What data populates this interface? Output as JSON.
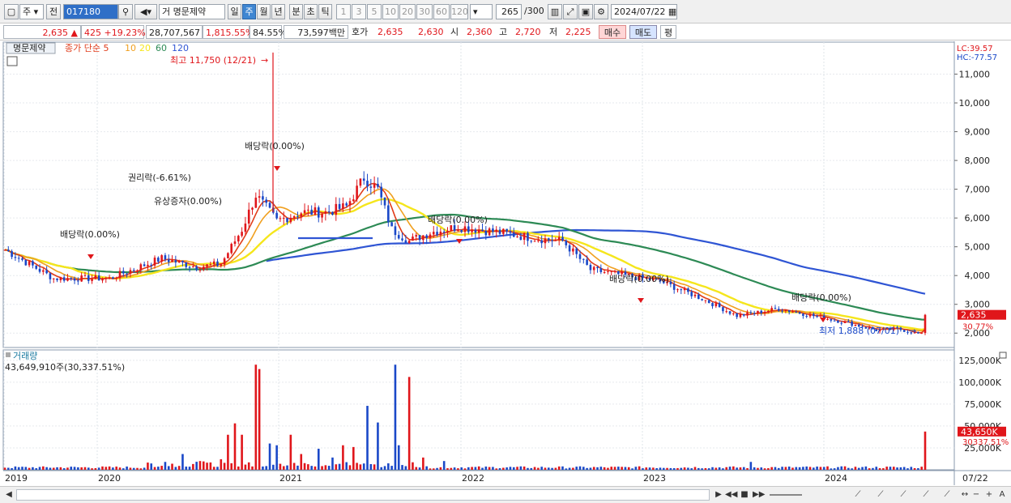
{
  "toolbar": {
    "mode": "주",
    "prev": "전",
    "code": "017180",
    "type": "거",
    "name": "명문제약",
    "periods": [
      "일",
      "주",
      "월",
      "년",
      "분",
      "초",
      "틱"
    ],
    "period_active": "주",
    "intervals": [
      "1",
      "3",
      "5",
      "10",
      "20",
      "30",
      "60",
      "120"
    ],
    "count": "265",
    "count_total": "/300",
    "date": "2024/07/22"
  },
  "quote": {
    "price": "2,635",
    "arrow": "▲",
    "change": "425",
    "change_pct": "+19.23%",
    "volume": "28,707,567",
    "volume_pct": "1,815.55%",
    "turnover_pct": "84.55%",
    "amount": "73,597백만",
    "hoga_label": "호가",
    "ask": "2,635",
    "bid": "2,630",
    "open_label": "시",
    "open": "2,360",
    "high_label": "고",
    "high": "2,720",
    "low_label": "저",
    "low": "2,225",
    "buy_label": "매수",
    "sell_label": "매도",
    "eval_label": "평"
  },
  "legend": {
    "stock": "명문제약",
    "ma_label": "종가 단순",
    "ma_periods": [
      "5",
      "10",
      "20",
      "60",
      "120"
    ],
    "lc": "LC:39.57",
    "hc": "HC:-77.57"
  },
  "annotations": {
    "high": "최고 11,750 (12/21)",
    "low": "최저 1,888 (07/01)",
    "div1": "배당락(0.00%)",
    "rights": "권리락(-6.61%)",
    "bonus": "유상증자(0.00%)",
    "div2": "배당락(0.00%)",
    "div3": "배당락(0.00%)",
    "div4": "배당락(0.00%)",
    "div5": "배당락(0.00%)"
  },
  "price_axis": {
    "labels": [
      "11,000",
      "10,000",
      "9,000",
      "8,000",
      "7,000",
      "6,000",
      "5,000",
      "4,000",
      "3,000",
      "2,000"
    ],
    "current": "2,635",
    "current_pct": "30.77%"
  },
  "volume_panel": {
    "title": "거래량",
    "value": "43,649,910주(30,337.51%)",
    "labels": [
      "125,000K",
      "100,000K",
      "75,000K",
      "50,000K",
      "25,000K"
    ],
    "current": "43,650K",
    "current_pct": "30337.51%"
  },
  "time_axis": {
    "labels": [
      "2019",
      "2020",
      "2021",
      "2022",
      "2023",
      "2024"
    ],
    "last": "07/22"
  },
  "colors": {
    "up": "#e0161b",
    "down": "#1a48c8",
    "ma5": "#e03c1a",
    "ma10": "#f0a020",
    "ma20": "#f5e61c",
    "ma60": "#2d8a55",
    "ma120": "#2f55d4"
  },
  "chart_data": {
    "type": "candlestick",
    "x": [
      "2019",
      "2020",
      "2021",
      "2022",
      "2023",
      "2024",
      "07/22"
    ],
    "price_points": [
      {
        "x": "2019",
        "close": 4800
      },
      {
        "x": "2020",
        "close": 4500
      },
      {
        "x": "2021",
        "close": 6500
      },
      {
        "x": "2022",
        "close": 4400
      },
      {
        "x": "2023",
        "close": 2800
      },
      {
        "x": "2024",
        "close": 2200
      },
      {
        "x": "07/22",
        "close": 2635
      }
    ],
    "high": {
      "value": 11750,
      "date": "12/21"
    },
    "low": {
      "value": 1888,
      "date": "07/01"
    },
    "ylim": [
      1500,
      12000
    ],
    "volume_ylim": [
      0,
      135000
    ]
  }
}
